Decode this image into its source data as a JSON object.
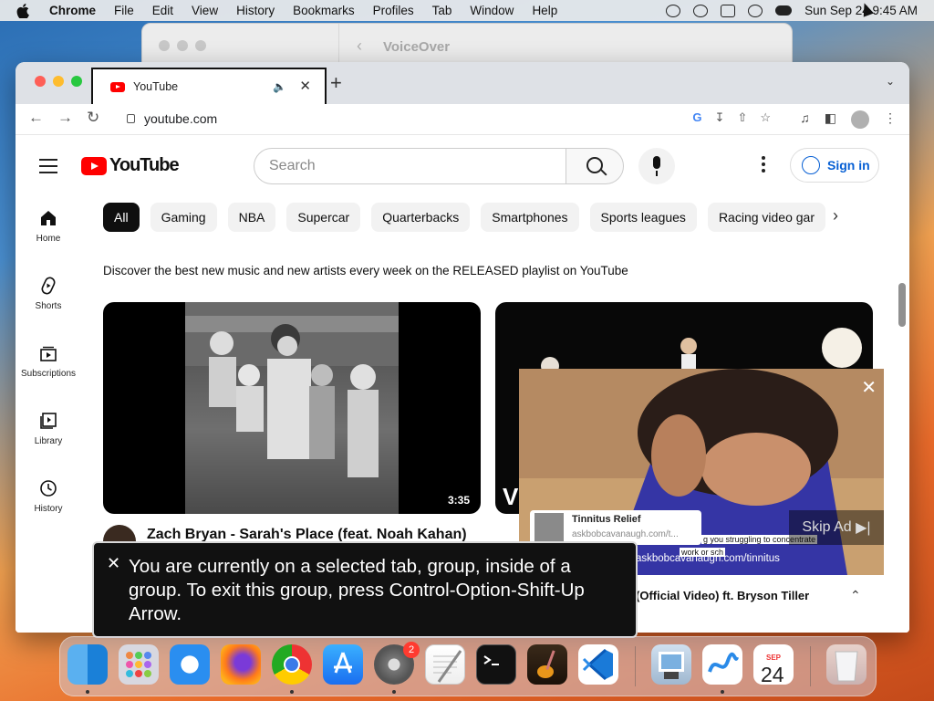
{
  "menubar": {
    "app_name": "Chrome",
    "items": [
      "File",
      "Edit",
      "View",
      "History",
      "Bookmarks",
      "Profiles",
      "Tab",
      "Window",
      "Help"
    ],
    "datetime": "Sun Sep 24  9:45 AM"
  },
  "voiceover_window": {
    "title": "VoiceOver"
  },
  "browser": {
    "tab_title": "YouTube",
    "url": "youtube.com"
  },
  "youtube": {
    "logo_text": "YouTube",
    "search_placeholder": "Search",
    "signin_label": "Sign in",
    "sidebar": [
      {
        "label": "Home",
        "icon": "home-icon"
      },
      {
        "label": "Shorts",
        "icon": "shorts-icon"
      },
      {
        "label": "Subscriptions",
        "icon": "subscriptions-icon"
      },
      {
        "label": "Library",
        "icon": "library-icon"
      },
      {
        "label": "History",
        "icon": "history-icon"
      }
    ],
    "chips": [
      "All",
      "Gaming",
      "NBA",
      "Supercar",
      "Quarterbacks",
      "Smartphones",
      "Sports leagues",
      "Racing video gar"
    ],
    "playlist_text": "Discover the best new music and new artists every week on the RELEASED playlist on YouTube",
    "videos": [
      {
        "title": "Zach Bryan - Sarah's Place (feat. Noah Kahan)",
        "duration": "3:35"
      },
      {
        "title": "(Official Video) ft. Bryson Tiller"
      }
    ],
    "ad": {
      "advertiser": "Tinnitus Relief",
      "advertiser_url": "askbobcavanaugh.com/t...",
      "caption_text": "g you struggling to concentrate",
      "caption_text2": "work or sch",
      "overlay_url": "askbobcavanaugh.com/tinnitus",
      "skip_label": "Skip Ad"
    }
  },
  "voiceover_caption": {
    "text": "You are currently on a selected tab, group, inside of a group.  To exit this group, press Control-Option-Shift-Up Arrow."
  },
  "dock": {
    "settings_badge": "2",
    "calendar_month": "SEP",
    "calendar_day": "24"
  }
}
